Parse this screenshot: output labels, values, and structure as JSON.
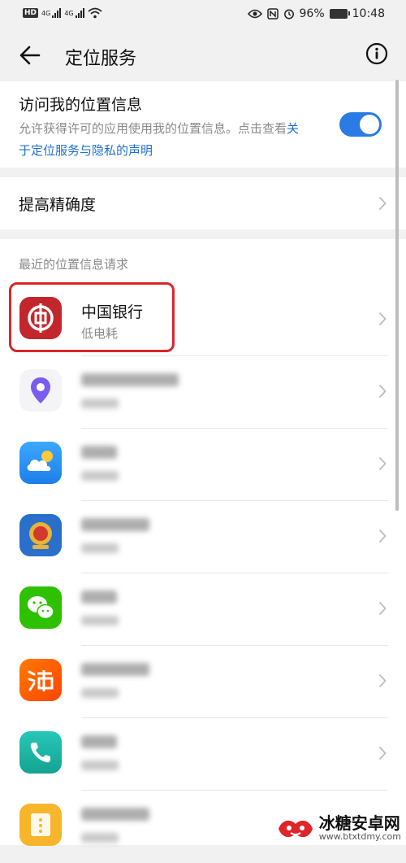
{
  "status_bar": {
    "hd": "HD",
    "net1": "4G",
    "net2": "4G",
    "battery": "96%",
    "time": "10:48"
  },
  "header": {
    "title": "定位服务"
  },
  "location_access": {
    "title": "访问我的位置信息",
    "desc_text": "允许获得许可的应用使用我的位置信息。点击查看",
    "desc_link": "关于定位服务与隐私的声明",
    "enabled": true,
    "accent": "#2a7be4"
  },
  "accuracy": {
    "label": "提高精确度"
  },
  "recent": {
    "section_label": "最近的位置信息请求",
    "apps": [
      {
        "name": "中国银行",
        "sub": "低电耗",
        "icon": "boc-icon",
        "color": "#c1272d",
        "blurred": false
      },
      {
        "name": "",
        "sub": "",
        "icon": "location-pin-icon",
        "color": "#7b5cf0",
        "blurred": true
      },
      {
        "name": "",
        "sub": "",
        "icon": "weather-icon",
        "color": "#3aa0f5",
        "blurred": true
      },
      {
        "name": "",
        "sub": "",
        "icon": "tax-emblem-icon",
        "color": "#2a6fc9",
        "blurred": true
      },
      {
        "name": "",
        "sub": "",
        "icon": "wechat-icon",
        "color": "#2dc100",
        "blurred": true
      },
      {
        "name": "",
        "sub": "",
        "icon": "taobao-icon",
        "color": "#ff5a00",
        "blurred": true
      },
      {
        "name": "",
        "sub": "",
        "icon": "phone-icon",
        "color": "#1fb6a8",
        "blurred": true
      },
      {
        "name": "",
        "sub": "",
        "icon": "file-manager-icon",
        "color": "#f7b52c",
        "blurred": true
      }
    ]
  },
  "highlight_color": "#d9262c",
  "watermark": {
    "main": "冰糖安卓网",
    "url": "www.btxtdmy.com"
  }
}
